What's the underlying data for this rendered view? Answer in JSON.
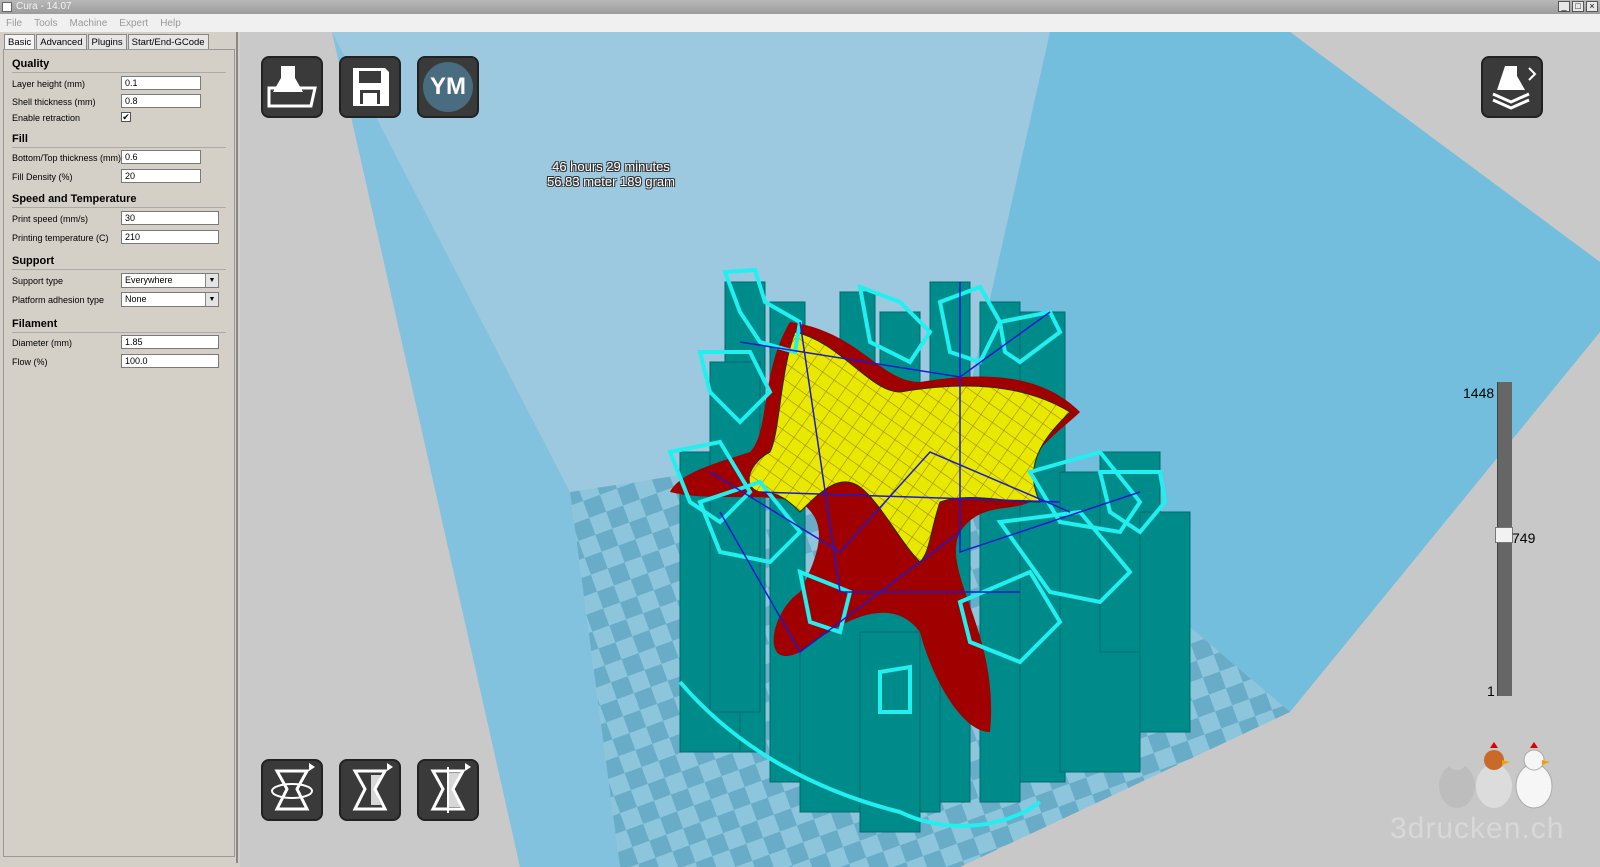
{
  "window": {
    "title": "Cura - 14.07",
    "controls": [
      "_",
      "□",
      "×"
    ]
  },
  "menu": [
    "File",
    "Tools",
    "Machine",
    "Expert",
    "Help"
  ],
  "tabs": [
    "Basic",
    "Advanced",
    "Plugins",
    "Start/End-GCode"
  ],
  "settings": {
    "quality": {
      "title": "Quality",
      "layer_height_label": "Layer height (mm)",
      "layer_height": "0.1",
      "shell_thickness_label": "Shell thickness (mm)",
      "shell_thickness": "0.8",
      "retraction_label": "Enable retraction",
      "retraction_mark": "✔"
    },
    "fill": {
      "title": "Fill",
      "bottom_top_label": "Bottom/Top thickness (mm)",
      "bottom_top": "0.6",
      "density_label": "Fill Density (%)",
      "density": "20"
    },
    "speed": {
      "title": "Speed and Temperature",
      "print_speed_label": "Print speed (mm/s)",
      "print_speed": "30",
      "temp_label": "Printing temperature (C)",
      "temp": "210"
    },
    "support": {
      "title": "Support",
      "type_label": "Support type",
      "type": "Everywhere",
      "adhesion_label": "Platform adhesion type",
      "adhesion": "None"
    },
    "filament": {
      "title": "Filament",
      "diameter_label": "Diameter (mm)",
      "diameter": "1.85",
      "flow_label": "Flow (%)",
      "flow": "100.0"
    }
  },
  "print_info": {
    "time": "46 hours 29 minutes",
    "material": "56.83 meter 189 gram"
  },
  "ym_button": "YM",
  "layer_slider": {
    "max": "1448",
    "current": "749",
    "min": "1"
  },
  "watermark": "3drucken.ch",
  "icons": [
    "load-icon",
    "save-icon",
    "view-mode-icon",
    "rotate-icon",
    "scale-icon",
    "mirror-icon",
    "chickens-icon"
  ],
  "colors": {
    "shell": "#00f0f0",
    "infill": "#e8e800",
    "support": "#008080",
    "travel": "#1515d0",
    "top_bottom": "#a00000",
    "build_volume": "#5bb7dc"
  }
}
